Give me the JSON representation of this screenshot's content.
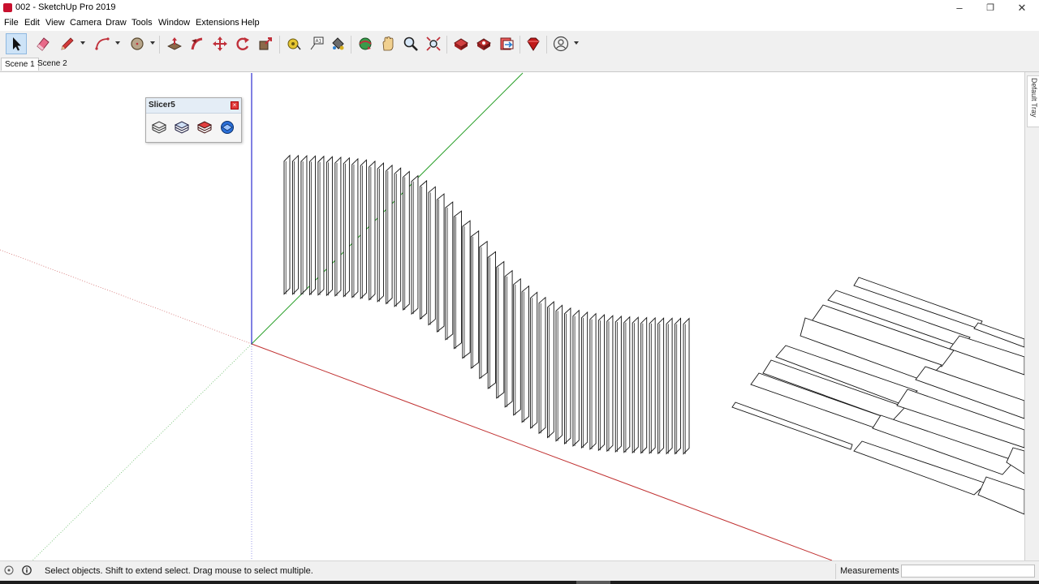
{
  "window": {
    "title": "002 - SketchUp Pro 2019",
    "controls": [
      "–",
      "❐",
      "✕"
    ]
  },
  "menu": [
    "File",
    "Edit",
    "View",
    "Camera",
    "Draw",
    "Tools",
    "Window",
    "Extensions",
    "Help"
  ],
  "toolbar": {
    "tools": [
      "select-icon",
      "eraser-icon",
      "pencil-icon",
      "arc-icon",
      "circle-icon",
      "push-pull-icon",
      "follow-me-icon",
      "move-icon",
      "rotate-icon",
      "scale-icon",
      "tape-measure-icon",
      "text-icon",
      "paint-bucket-icon",
      "orbit-icon",
      "pan-icon",
      "zoom-icon",
      "zoom-extents-icon",
      "3d-warehouse-icon",
      "extension-warehouse-icon",
      "layout-icon",
      "ruby-extension-icon",
      "account-icon"
    ],
    "active_tool": "select-icon"
  },
  "scenes": [
    "Scene 1",
    "Scene 2"
  ],
  "active_scene": "Scene 1",
  "tray": {
    "label": "Default Tray"
  },
  "slicer_panel": {
    "title": "Slicer5",
    "buttons": [
      "slice-model-icon",
      "slice-settings-icon",
      "slice-layout-icon",
      "slice-export-icon"
    ]
  },
  "axes": {
    "red": "#c03030",
    "green": "#2aa02a",
    "blue": "#2b2bd0"
  },
  "status": {
    "message": "Select objects. Shift to extend select. Drag mouse to select multiple.",
    "measurements_label": "Measurements",
    "measurements_value": ""
  }
}
